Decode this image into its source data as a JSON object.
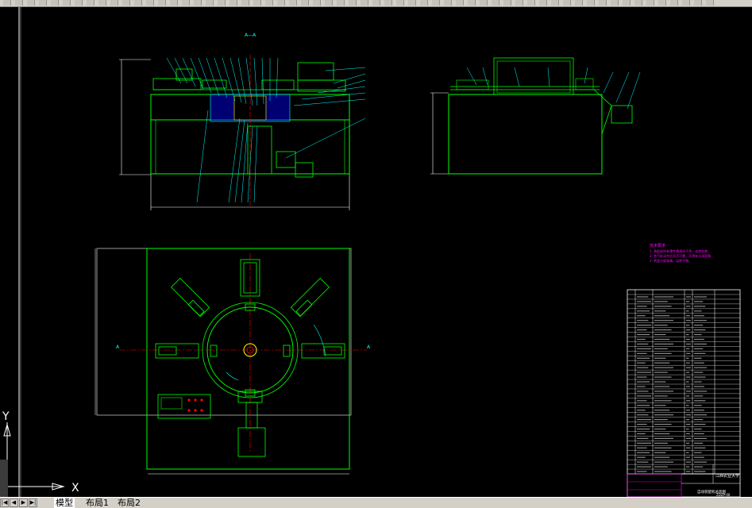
{
  "drawing": {
    "section_label": "A—A",
    "section_marker": "A",
    "axis": {
      "y_label": "Y",
      "x_label": "X"
    },
    "notes": {
      "heading": "技术要求",
      "lines": [
        "1. 装配前所有零件需清洗干净，去除毛刺；",
        "2. 各气缸动作应灵活可靠，不得有卡滞现象；",
        "3. 转盘分度准确，运转平稳。"
      ]
    },
    "title_block": {
      "school": "江西农业大学",
      "drawing_name": "自动装配机总装图",
      "drawing_no": "ZDZP-00"
    },
    "colors": {
      "outline": "#00ff00",
      "frame": "#ffffff",
      "center_line": "#ff0000",
      "dimension": "#00ffff",
      "hatch": "#0000ff",
      "leader": "#00ffff",
      "notes": "#ff00ff",
      "part": "#ffff00"
    }
  },
  "tabs": [
    {
      "label": "模型",
      "active": true
    },
    {
      "label": "布局1",
      "active": false
    },
    {
      "label": "布局2",
      "active": false
    }
  ],
  "nav": {
    "first": "|◀",
    "prev": "◀",
    "next": "▶",
    "last": "▶|"
  }
}
